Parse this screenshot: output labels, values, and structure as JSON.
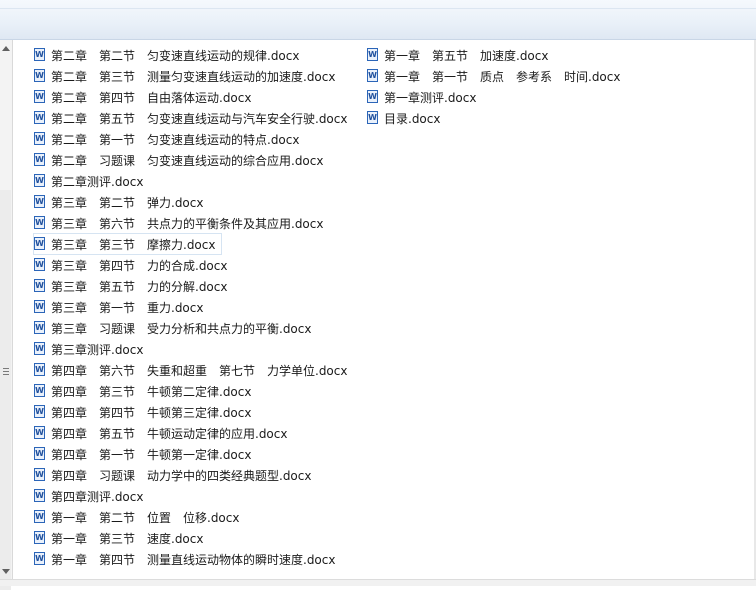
{
  "icon": "word-docx-icon",
  "files_column_1": [
    "第二章　第二节　匀变速直线运动的规律.docx",
    "第二章　第三节　测量匀变速直线运动的加速度.docx",
    "第二章　第四节　自由落体运动.docx",
    "第二章　第五节　匀变速直线运动与汽车安全行驶.docx",
    "第二章　第一节　匀变速直线运动的特点.docx",
    "第二章　习题课　匀变速直线运动的综合应用.docx",
    "第二章测评.docx",
    "第三章　第二节　弹力.docx",
    "第三章　第六节　共点力的平衡条件及其应用.docx",
    "第三章　第三节　摩擦力.docx",
    "第三章　第四节　力的合成.docx",
    "第三章　第五节　力的分解.docx",
    "第三章　第一节　重力.docx",
    "第三章　习题课　受力分析和共点力的平衡.docx",
    "第三章测评.docx",
    "第四章　第六节　失重和超重　第七节　力学单位.docx",
    "第四章　第三节　牛顿第二定律.docx",
    "第四章　第四节　牛顿第三定律.docx",
    "第四章　第五节　牛顿运动定律的应用.docx",
    "第四章　第一节　牛顿第一定律.docx",
    "第四章　习题课　动力学中的四类经典题型.docx",
    "第四章测评.docx",
    "第一章　第二节　位置　位移.docx",
    "第一章　第三节　速度.docx",
    "第一章　第四节　测量直线运动物体的瞬时速度.docx"
  ],
  "files_column_2": [
    "第一章　第五节　加速度.docx",
    "第一章　第一节　质点　参考系　时间.docx",
    "第一章测评.docx",
    "目录.docx"
  ],
  "selected_file": "第三章　第三节　摩擦力.docx"
}
